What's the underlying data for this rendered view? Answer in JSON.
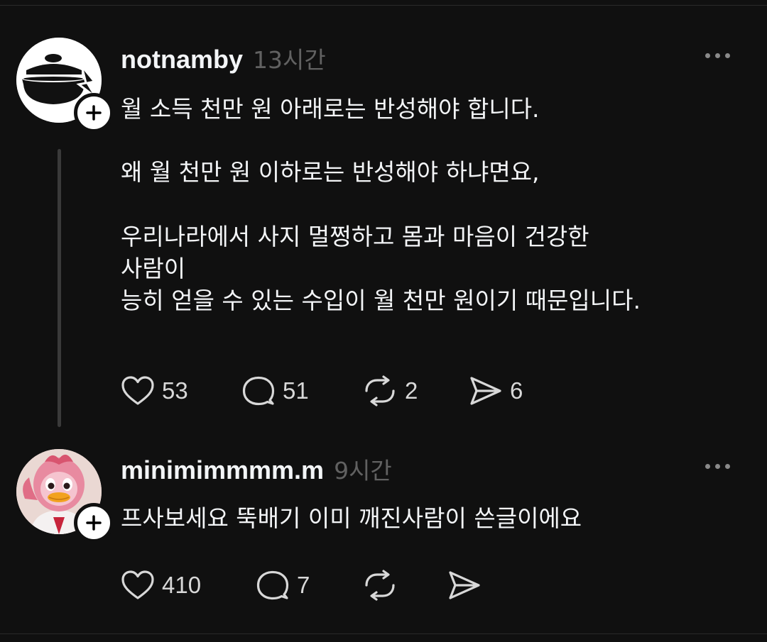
{
  "posts": [
    {
      "username": "notnamby",
      "time": "13시간",
      "avatar_icon": "pot-lightning-icon",
      "paragraphs": [
        [
          "월 소득 천만 원 아래로는 반성해야 합니다."
        ],
        [
          "왜 월 천만 원 이하로는 반성해야 하냐면요,"
        ],
        [
          "우리나라에서 사지 멀쩡하고 몸과 마음이 건강한",
          "사람이",
          "능히 얻을 수 있는 수입이 월 천만 원이기 때문입니다."
        ]
      ],
      "likes": "53",
      "comments": "51",
      "reposts": "2",
      "shares": "6"
    },
    {
      "username": "minimimmmm.m",
      "time": "9시간",
      "avatar_icon": "pink-mascot-avatar",
      "paragraphs": [
        [
          "프사보세요 뚝배기 이미 깨진사람이 쓴글이에요"
        ]
      ],
      "likes": "410",
      "comments": "7",
      "reposts": "",
      "shares": ""
    }
  ],
  "colors": {
    "background": "#101010",
    "text": "#f3f5f7",
    "muted": "#616161",
    "thread_line": "#3a3a3a"
  }
}
